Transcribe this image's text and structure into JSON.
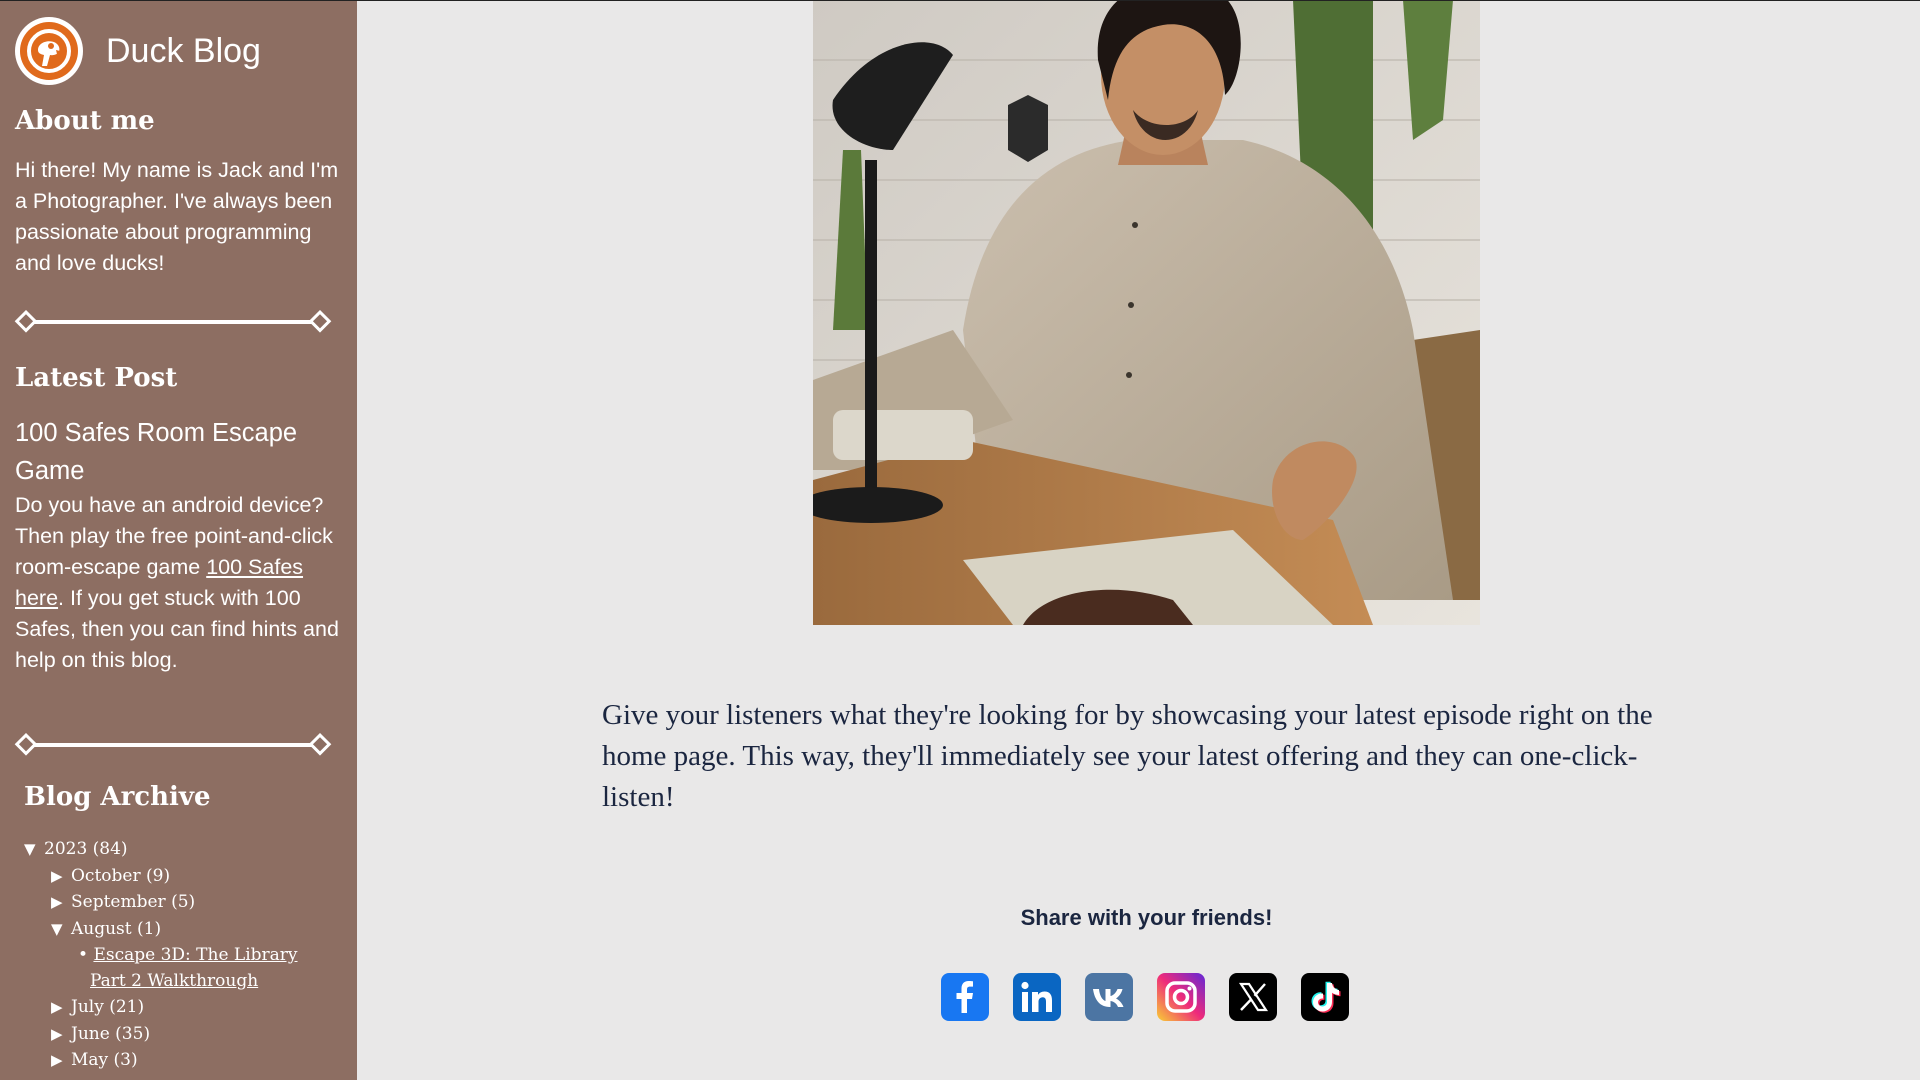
{
  "brand": {
    "title": "Duck Blog",
    "accent": "#e06a1c"
  },
  "about": {
    "heading": "About me",
    "text": "Hi there! My name is Jack and I'm a Photographer. I've always been passionate about programming and love ducks!"
  },
  "latest": {
    "heading": "Latest Post",
    "post_title": "100 Safes Room Escape Game",
    "text_before": "Do you have an android device? Then play the free point-and-click room-escape game ",
    "link": "100 Safes here",
    "text_after": ". If you get stuck with 100 Safes, then you can find hints and help on this blog."
  },
  "archive": {
    "heading": "Blog Archive",
    "year": {
      "label": "2023 (84)",
      "expanded": true
    },
    "months": [
      {
        "label": "October (9)",
        "expanded": false
      },
      {
        "label": "September (5)",
        "expanded": false
      },
      {
        "label": "August (1)",
        "expanded": true
      },
      {
        "label": "July (21)",
        "expanded": false
      },
      {
        "label": "June (35)",
        "expanded": false
      },
      {
        "label": "May (3)",
        "expanded": false
      }
    ],
    "august_post_line1": "Escape 3D: The Library",
    "august_post_line2": "Part 2 Walkthrough"
  },
  "main": {
    "body_text": "Give your listeners what they're looking for by showcasing your latest episode right on the home page. This way, they'll immediately see your latest offering and they can one-click-listen!"
  },
  "share": {
    "title": "Share with your friends!",
    "icons": [
      "facebook-icon",
      "linkedin-icon",
      "vk-icon",
      "instagram-icon",
      "x-icon",
      "tiktok-icon"
    ]
  },
  "colors": {
    "sidebar": "#8d6e62",
    "page": "#e9e8e8",
    "text": "#1b2640"
  }
}
